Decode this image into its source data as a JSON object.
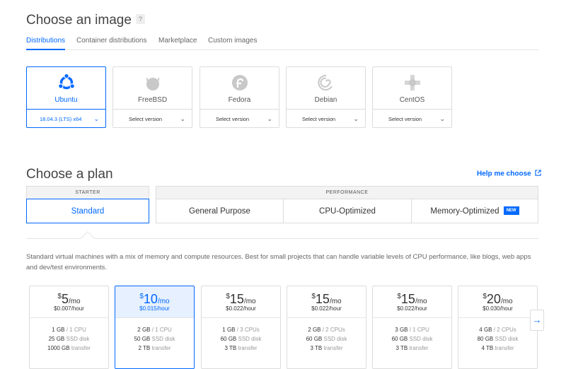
{
  "image_section": {
    "title": "Choose an image",
    "help": "?",
    "tabs": [
      {
        "label": "Distributions",
        "active": true
      },
      {
        "label": "Container distributions",
        "active": false
      },
      {
        "label": "Marketplace",
        "active": false
      },
      {
        "label": "Custom images",
        "active": false
      }
    ],
    "distros": [
      {
        "name": "Ubuntu",
        "version": "18.04.3 (LTS) x64",
        "icon": "ubuntu-icon",
        "active": true
      },
      {
        "name": "FreeBSD",
        "version": "Select version",
        "icon": "freebsd-icon",
        "active": false
      },
      {
        "name": "Fedora",
        "version": "Select version",
        "icon": "fedora-icon",
        "active": false
      },
      {
        "name": "Debian",
        "version": "Select version",
        "icon": "debian-icon",
        "active": false
      },
      {
        "name": "CentOS",
        "version": "Select version",
        "icon": "centos-icon",
        "active": false
      }
    ]
  },
  "plan_section": {
    "title": "Choose a plan",
    "help_link": "Help me choose",
    "starter_label": "STARTER",
    "performance_label": "PERFORMANCE",
    "plans": {
      "standard": "Standard",
      "general": "General Purpose",
      "cpu": "CPU-Optimized",
      "memory": "Memory-Optimized",
      "new_badge": "NEW"
    },
    "description": "Standard virtual machines with a mix of memory and compute resources. Best for small projects that can handle variable levels of CPU performance, like blogs, web apps and dev/test environments.",
    "prices": [
      {
        "currency": "$",
        "amount": "5",
        "per": "/mo",
        "hourly": "$0.007",
        "hour_unit": "/hour",
        "mem": "1 GB",
        "cpu": "1 CPU",
        "disk": "25 GB",
        "disk_unit": "SSD disk",
        "transfer": "1000 GB",
        "transfer_unit": "transfer",
        "active": false
      },
      {
        "currency": "$",
        "amount": "10",
        "per": "/mo",
        "hourly": "$0.015",
        "hour_unit": "/hour",
        "mem": "2 GB",
        "cpu": "1 CPU",
        "disk": "50 GB",
        "disk_unit": "SSD disk",
        "transfer": "2 TB",
        "transfer_unit": "transfer",
        "active": true
      },
      {
        "currency": "$",
        "amount": "15",
        "per": "/mo",
        "hourly": "$0.022",
        "hour_unit": "/hour",
        "mem": "1 GB",
        "cpu": "3 CPUs",
        "disk": "60 GB",
        "disk_unit": "SSD disk",
        "transfer": "3 TB",
        "transfer_unit": "transfer",
        "active": false
      },
      {
        "currency": "$",
        "amount": "15",
        "per": "/mo",
        "hourly": "$0.022",
        "hour_unit": "/hour",
        "mem": "2 GB",
        "cpu": "2 CPUs",
        "disk": "60 GB",
        "disk_unit": "SSD disk",
        "transfer": "3 TB",
        "transfer_unit": "transfer",
        "active": false
      },
      {
        "currency": "$",
        "amount": "15",
        "per": "/mo",
        "hourly": "$0.022",
        "hour_unit": "/hour",
        "mem": "3 GB",
        "cpu": "1 CPU",
        "disk": "60 GB",
        "disk_unit": "SSD disk",
        "transfer": "3 TB",
        "transfer_unit": "transfer",
        "active": false
      },
      {
        "currency": "$",
        "amount": "20",
        "per": "/mo",
        "hourly": "$0.030",
        "hour_unit": "/hour",
        "mem": "4 GB",
        "cpu": "2 CPUs",
        "disk": "80 GB",
        "disk_unit": "SSD disk",
        "transfer": "4 TB",
        "transfer_unit": "transfer",
        "active": false
      }
    ]
  },
  "colors": {
    "accent": "#0069ff",
    "border": "#dcdcdc",
    "muted": "#999999"
  }
}
